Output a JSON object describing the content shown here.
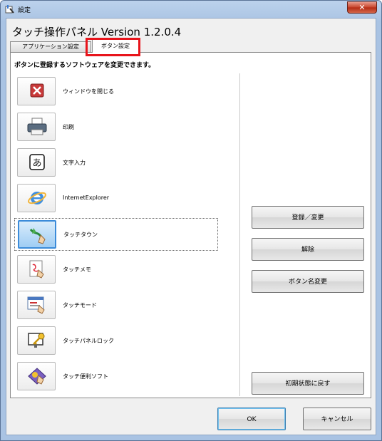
{
  "window": {
    "title": "設定",
    "close_glyph": "✕"
  },
  "heading": "タッチ操作パネル  Version 1.2.0.4",
  "tabs": [
    {
      "label": "アプリケーション設定",
      "active": false
    },
    {
      "label": "ボタン設定",
      "active": true
    }
  ],
  "panel": {
    "description": "ボタンに登録するソフトウェアを変更できます。"
  },
  "items": [
    {
      "label": "ウィンドウを閉じる",
      "icon": "close-window-icon",
      "selected": false
    },
    {
      "label": "印刷",
      "icon": "printer-icon",
      "selected": false
    },
    {
      "label": "文字入力",
      "icon": "text-input-icon",
      "selected": false
    },
    {
      "label": "InternetExplorer",
      "icon": "internet-explorer-icon",
      "selected": false
    },
    {
      "label": "タッチタウン",
      "icon": "touch-town-icon",
      "selected": true
    },
    {
      "label": "タッチメモ",
      "icon": "touch-memo-icon",
      "selected": false
    },
    {
      "label": "タッチモード",
      "icon": "touch-mode-icon",
      "selected": false
    },
    {
      "label": "タッチパネルロック",
      "icon": "touch-panel-lock-icon",
      "selected": false
    },
    {
      "label": "タッチ便利ソフト",
      "icon": "touch-utility-icon",
      "selected": false
    }
  ],
  "side_buttons": {
    "register": "登録／変更",
    "remove": "解除",
    "rename": "ボタン名変更",
    "reset": "初期状態に戻す"
  },
  "footer": {
    "ok": "OK",
    "cancel": "キャンセル"
  },
  "colors": {
    "highlight": "#e8141b",
    "selection": "#3b8bd9"
  }
}
